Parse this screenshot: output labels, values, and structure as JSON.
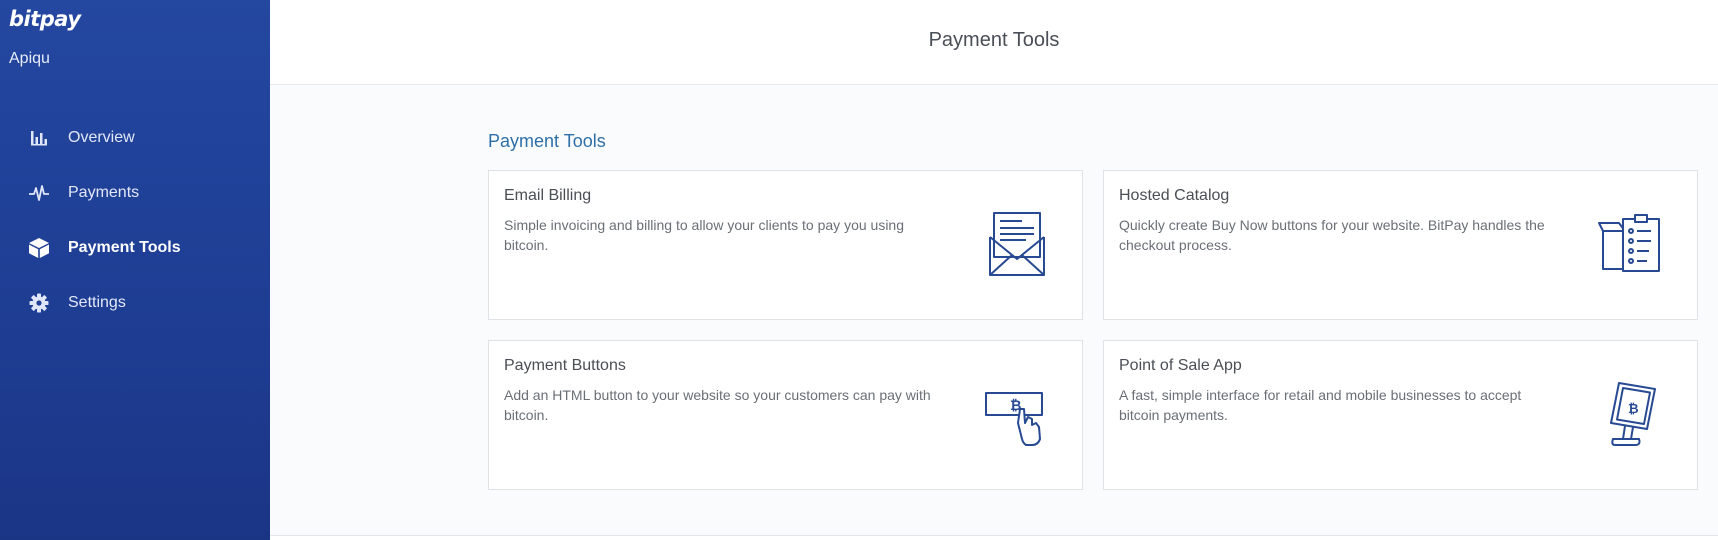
{
  "sidebar": {
    "logo": "bitpay",
    "org_name": "Apiqu",
    "items": [
      {
        "label": "Overview",
        "icon": "bar-chart-icon",
        "active": false
      },
      {
        "label": "Payments",
        "icon": "pulse-icon",
        "active": false
      },
      {
        "label": "Payment Tools",
        "icon": "cube-icon",
        "active": true
      },
      {
        "label": "Settings",
        "icon": "gear-icon",
        "active": false
      }
    ]
  },
  "header": {
    "title": "Payment Tools"
  },
  "main": {
    "section_title": "Payment Tools",
    "cards": [
      {
        "title": "Email Billing",
        "description": "Simple invoicing and billing to allow your clients to pay you using bitcoin.",
        "icon": "envelope-icon"
      },
      {
        "title": "Hosted Catalog",
        "description": "Quickly create Buy Now buttons for your website. BitPay handles the checkout process.",
        "icon": "catalog-icon"
      },
      {
        "title": "Payment Buttons",
        "description": "Add an HTML button to your website so your customers can pay with bitcoin.",
        "icon": "bitcoin-button-icon"
      },
      {
        "title": "Point of Sale App",
        "description": "A fast, simple interface for retail and mobile businesses to accept bitcoin payments.",
        "icon": "pos-tablet-icon"
      }
    ]
  },
  "colors": {
    "sidebar_bg": "#1e3d93",
    "accent_blue": "#2f6fa8",
    "illustration_stroke": "#274a93"
  }
}
